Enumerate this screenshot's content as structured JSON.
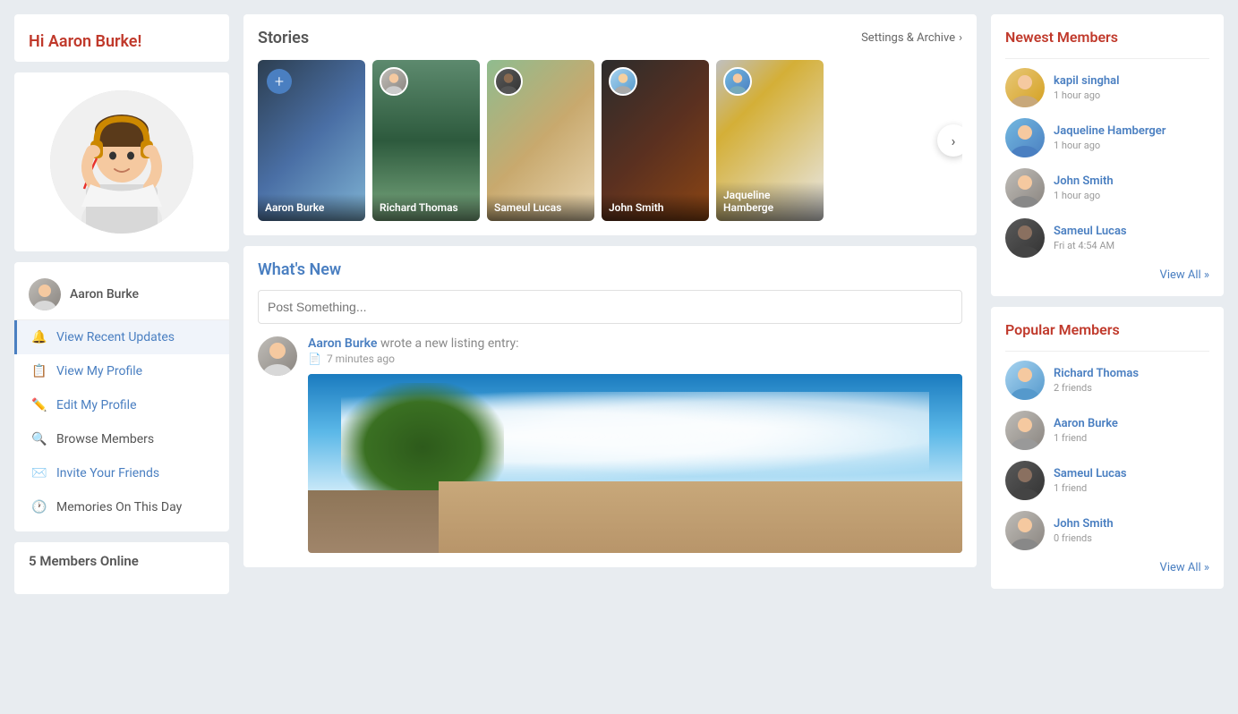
{
  "greeting": {
    "hi": "Hi ",
    "name": "Aaron Burke!"
  },
  "nav": {
    "user_name": "Aaron Burke",
    "items": [
      {
        "id": "recent-updates",
        "label": "View Recent Updates",
        "icon": "🔔",
        "active": true
      },
      {
        "id": "view-profile",
        "label": "View My Profile",
        "icon": "📋",
        "active": false
      },
      {
        "id": "edit-profile",
        "label": "Edit My Profile",
        "icon": "✏️",
        "active": false
      },
      {
        "id": "browse-members",
        "label": "Browse Members",
        "icon": "🔍",
        "active": false
      },
      {
        "id": "invite-friends",
        "label": "Invite Your Friends",
        "icon": "✉️",
        "active": false
      },
      {
        "id": "memories",
        "label": "Memories On This Day",
        "icon": "🕐",
        "active": false
      }
    ]
  },
  "members_online": {
    "count": "5",
    "label": "Members Online"
  },
  "stories": {
    "title": "Stories",
    "settings_label": "Settings & Archive",
    "items": [
      {
        "name": "Aaron Burke",
        "add": true
      },
      {
        "name": "Richard Thomas",
        "add": false
      },
      {
        "name": "Sameul Lucas",
        "add": false
      },
      {
        "name": "John Smith",
        "add": false
      },
      {
        "name": "Jaqueline Hamberge",
        "add": false
      }
    ]
  },
  "whats_new": {
    "title": "What's New",
    "placeholder": "Post Something..."
  },
  "activity": {
    "user": "Aaron Burke",
    "action": "wrote a new listing entry:",
    "time": "7 minutes ago"
  },
  "newest_members": {
    "title": "Newest Members",
    "view_all": "View All »",
    "items": [
      {
        "name": "kapil singhal",
        "time": "1 hour ago"
      },
      {
        "name": "Jaqueline Hamberger",
        "time": "1 hour ago"
      },
      {
        "name": "John Smith",
        "time": "1 hour ago"
      },
      {
        "name": "Sameul Lucas",
        "time": "Fri at 4:54 AM"
      }
    ]
  },
  "popular_members": {
    "title": "Popular Members",
    "view_all": "View All »",
    "items": [
      {
        "name": "Richard Thomas",
        "friends": "2 friends"
      },
      {
        "name": "Aaron Burke",
        "friends": "1 friend"
      },
      {
        "name": "Sameul Lucas",
        "friends": "1 friend"
      },
      {
        "name": "John Smith",
        "friends": "0 friends"
      }
    ]
  }
}
